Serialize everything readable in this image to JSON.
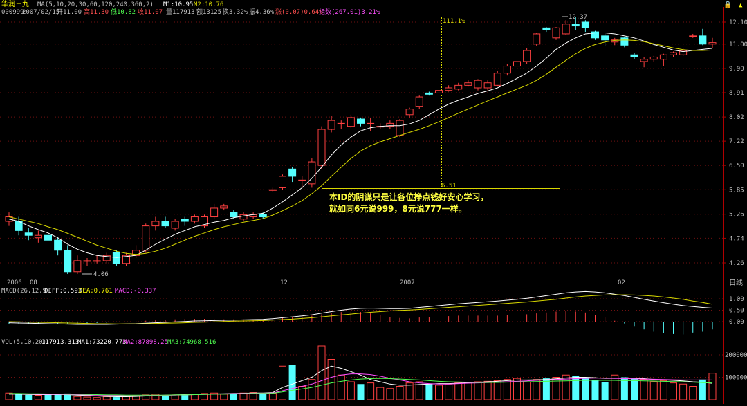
{
  "header": {
    "stock_name": "华润三九",
    "ma_params": "MA(5,10,20,30,60,120,240,360,2)",
    "m1": "M1:10.95",
    "m2": "M2:10.76",
    "code": "000999",
    "date": "2007/02/15",
    "open": "开11.00",
    "high": "高11.30",
    "low": "低10.82",
    "close": "收11.07",
    "volume": "量117913",
    "amount": "额13125",
    "turnover": "换3.32%",
    "amplitude": "振4.36%",
    "change": "涨(0.07)0.64%",
    "index": "指数(267.01)3.21%",
    "colors": {
      "name": "#ffff00",
      "label": "#c0c0c0",
      "up": "#ff5050",
      "down": "#50ff50",
      "index": "#ff50ff"
    }
  },
  "annotation": {
    "line1": "本ID的阴谋只是让各位挣点钱好安心学习，",
    "line2": "就如同6元说999，8元说777一样。",
    "pct_label": "111.1%",
    "low_mark": "6.51",
    "peak_mark": "12.37",
    "min_mark": "4.06"
  },
  "time_axis": {
    "labels": [
      "2006",
      "08",
      "12",
      "2007",
      "02"
    ],
    "period": "日线"
  },
  "macd_header": {
    "name": "MACD(26,12,9)",
    "diff": "DIFF:0.593",
    "dea": "DEA:0.761",
    "macd": "MACD:-0.337"
  },
  "vol_header": {
    "name": "VOL(5,10,20)",
    "value": "117913.313",
    "ma1": "MA1:73220.773",
    "ma2": "MA2:87898.25",
    "ma3": "MA3:74968.516"
  },
  "chart_data": [
    {
      "type": "candlestick",
      "title": "",
      "ylim": [
        4.0,
        12.4
      ],
      "ytick_labels": [
        "12.10",
        "11.00",
        "9.90",
        "8.91",
        "8.02",
        "7.22",
        "6.50",
        "5.85",
        "5.26",
        "4.74",
        "4.26"
      ],
      "candles": [
        [
          5.1,
          5.2,
          5.3,
          5.0
        ],
        [
          5.1,
          4.9,
          5.2,
          4.8
        ],
        [
          4.85,
          4.8,
          4.95,
          4.7
        ],
        [
          4.75,
          4.8,
          4.9,
          4.65
        ],
        [
          4.8,
          4.7,
          4.9,
          4.6
        ],
        [
          4.7,
          4.5,
          4.75,
          4.4
        ],
        [
          4.5,
          4.1,
          4.6,
          4.06
        ],
        [
          4.1,
          4.3,
          4.4,
          4.06
        ],
        [
          4.3,
          4.3,
          4.35,
          4.2
        ],
        [
          4.3,
          4.3,
          4.4,
          4.25
        ],
        [
          4.3,
          4.4,
          4.45,
          4.25
        ],
        [
          4.45,
          4.25,
          4.5,
          4.2
        ],
        [
          4.25,
          4.4,
          4.45,
          4.2
        ],
        [
          4.4,
          4.5,
          4.6,
          4.35
        ],
        [
          4.5,
          5.0,
          5.05,
          4.45
        ],
        [
          5.0,
          5.1,
          5.2,
          4.9
        ],
        [
          5.1,
          5.0,
          5.2,
          4.95
        ],
        [
          4.95,
          5.1,
          5.15,
          4.9
        ],
        [
          5.15,
          5.1,
          5.2,
          5.0
        ],
        [
          5.1,
          5.2,
          5.25,
          5.05
        ],
        [
          5.0,
          5.2,
          5.25,
          4.95
        ],
        [
          5.2,
          5.4,
          5.5,
          5.15
        ],
        [
          5.4,
          5.45,
          5.5,
          5.35
        ],
        [
          5.3,
          5.2,
          5.35,
          5.15
        ],
        [
          5.15,
          5.25,
          5.3,
          5.1
        ],
        [
          5.2,
          5.25,
          5.3,
          5.15
        ],
        [
          5.25,
          5.2,
          5.3,
          5.15
        ],
        [
          5.85,
          5.85,
          5.9,
          5.8
        ],
        [
          5.9,
          6.2,
          6.25,
          5.85
        ],
        [
          6.4,
          6.2,
          6.45,
          6.05
        ],
        [
          6.1,
          6.1,
          6.2,
          5.9
        ],
        [
          6.0,
          6.6,
          6.7,
          5.9
        ],
        [
          6.5,
          7.6,
          7.7,
          6.4
        ],
        [
          7.6,
          7.9,
          8.05,
          7.5
        ],
        [
          7.8,
          7.8,
          7.9,
          7.6
        ],
        [
          7.7,
          8.0,
          8.1,
          7.65
        ],
        [
          7.95,
          7.8,
          8.0,
          7.7
        ],
        [
          7.8,
          7.8,
          8.0,
          7.55
        ],
        [
          7.7,
          7.7,
          7.8,
          7.6
        ],
        [
          7.7,
          7.8,
          7.9,
          7.6
        ],
        [
          7.4,
          7.9,
          7.95,
          7.35
        ],
        [
          8.1,
          8.3,
          8.35,
          8.0
        ],
        [
          8.4,
          8.75,
          8.8,
          8.3
        ],
        [
          8.9,
          8.85,
          8.95,
          8.8
        ],
        [
          8.9,
          9.0,
          9.05,
          8.8
        ],
        [
          9.0,
          9.1,
          9.2,
          8.95
        ],
        [
          9.05,
          9.2,
          9.3,
          9.0
        ],
        [
          9.2,
          9.3,
          9.4,
          9.15
        ],
        [
          9.1,
          9.4,
          9.45,
          9.0
        ],
        [
          9.1,
          9.3,
          9.4,
          9.0
        ],
        [
          9.2,
          9.7,
          9.8,
          9.15
        ],
        [
          9.7,
          10.0,
          10.1,
          9.6
        ],
        [
          10.0,
          10.2,
          10.25,
          9.9
        ],
        [
          10.2,
          10.7,
          10.8,
          10.1
        ],
        [
          11.0,
          11.5,
          11.55,
          10.9
        ],
        [
          11.8,
          11.7,
          11.85,
          11.6
        ],
        [
          11.3,
          11.8,
          11.85,
          11.2
        ],
        [
          11.5,
          12.0,
          12.2,
          11.45
        ],
        [
          12.0,
          11.9,
          12.37,
          11.7
        ],
        [
          12.1,
          11.8,
          12.2,
          11.6
        ],
        [
          11.6,
          11.3,
          11.65,
          11.2
        ],
        [
          11.4,
          11.2,
          11.5,
          10.9
        ],
        [
          11.1,
          11.2,
          11.3,
          10.95
        ],
        [
          11.3,
          10.95,
          11.35,
          10.85
        ],
        [
          10.5,
          10.4,
          10.6,
          10.3
        ],
        [
          10.2,
          10.3,
          10.4,
          9.95
        ],
        [
          10.3,
          10.4,
          10.45,
          10.2
        ],
        [
          10.3,
          10.5,
          10.55,
          10.0
        ],
        [
          10.5,
          10.6,
          10.65,
          10.4
        ],
        [
          10.5,
          10.7,
          10.8,
          10.45
        ],
        [
          11.4,
          11.4,
          11.5,
          11.3
        ],
        [
          11.4,
          11.0,
          11.75,
          10.95
        ],
        [
          11.0,
          11.07,
          11.3,
          10.82
        ]
      ],
      "ma_short": [
        5.15,
        5.1,
        5.0,
        4.92,
        4.85,
        4.75,
        4.62,
        4.52,
        4.45,
        4.4,
        4.38,
        4.36,
        4.38,
        4.4,
        4.5,
        4.62,
        4.72,
        4.82,
        4.9,
        4.98,
        5.03,
        5.08,
        5.12,
        5.18,
        5.22,
        5.25,
        5.28,
        5.4,
        5.55,
        5.72,
        5.9,
        6.15,
        6.45,
        6.8,
        7.1,
        7.35,
        7.55,
        7.65,
        7.7,
        7.72,
        7.72,
        7.78,
        7.9,
        8.1,
        8.3,
        8.48,
        8.62,
        8.75,
        8.88,
        8.98,
        9.1,
        9.28,
        9.48,
        9.7,
        10.0,
        10.35,
        10.75,
        11.05,
        11.3,
        11.5,
        11.55,
        11.55,
        11.5,
        11.4,
        11.3,
        11.15,
        10.98,
        10.85,
        10.72,
        10.65,
        10.7,
        10.75,
        10.8
      ],
      "ma_long": [
        5.2,
        5.15,
        5.1,
        5.05,
        4.98,
        4.92,
        4.84,
        4.76,
        4.68,
        4.6,
        4.54,
        4.48,
        4.44,
        4.42,
        4.44,
        4.48,
        4.54,
        4.62,
        4.7,
        4.78,
        4.85,
        4.92,
        4.98,
        5.03,
        5.08,
        5.12,
        5.16,
        5.24,
        5.34,
        5.45,
        5.58,
        5.75,
        5.95,
        6.2,
        6.45,
        6.7,
        6.92,
        7.08,
        7.2,
        7.3,
        7.4,
        7.5,
        7.6,
        7.72,
        7.85,
        8.0,
        8.15,
        8.3,
        8.45,
        8.6,
        8.75,
        8.9,
        9.05,
        9.2,
        9.4,
        9.65,
        9.95,
        10.25,
        10.55,
        10.8,
        10.98,
        11.1,
        11.18,
        11.2,
        11.18,
        11.12,
        11.02,
        10.92,
        10.82,
        10.74,
        10.7,
        10.7,
        10.72
      ]
    },
    {
      "type": "macd",
      "ylim": [
        0,
        1.5
      ],
      "ytick_labels": [
        "1.00",
        "0.50",
        "0.00"
      ],
      "diff": [
        -0.05,
        -0.06,
        -0.07,
        -0.08,
        -0.09,
        -0.1,
        -0.11,
        -0.12,
        -0.12,
        -0.12,
        -0.12,
        -0.11,
        -0.1,
        -0.09,
        -0.07,
        -0.05,
        -0.03,
        -0.01,
        0.01,
        0.03,
        0.04,
        0.05,
        0.06,
        0.07,
        0.08,
        0.09,
        0.1,
        0.13,
        0.17,
        0.21,
        0.25,
        0.3,
        0.37,
        0.44,
        0.5,
        0.55,
        0.58,
        0.59,
        0.58,
        0.57,
        0.57,
        0.58,
        0.62,
        0.66,
        0.7,
        0.74,
        0.78,
        0.81,
        0.84,
        0.87,
        0.9,
        0.94,
        0.98,
        1.02,
        1.08,
        1.14,
        1.2,
        1.26,
        1.3,
        1.32,
        1.3,
        1.26,
        1.2,
        1.14,
        1.06,
        0.98,
        0.9,
        0.83,
        0.76,
        0.7,
        0.66,
        0.62,
        0.59
      ],
      "dea": [
        0,
        -0.01,
        -0.02,
        -0.03,
        -0.04,
        -0.05,
        -0.06,
        -0.07,
        -0.08,
        -0.09,
        -0.09,
        -0.1,
        -0.1,
        -0.1,
        -0.09,
        -0.08,
        -0.07,
        -0.06,
        -0.05,
        -0.03,
        -0.02,
        -0.01,
        0.01,
        0.02,
        0.03,
        0.04,
        0.05,
        0.07,
        0.09,
        0.11,
        0.14,
        0.17,
        0.21,
        0.25,
        0.29,
        0.33,
        0.37,
        0.41,
        0.44,
        0.47,
        0.49,
        0.51,
        0.53,
        0.56,
        0.59,
        0.62,
        0.65,
        0.68,
        0.71,
        0.74,
        0.77,
        0.8,
        0.83,
        0.86,
        0.9,
        0.94,
        0.98,
        1.03,
        1.08,
        1.12,
        1.15,
        1.17,
        1.18,
        1.18,
        1.17,
        1.15,
        1.12,
        1.08,
        1.03,
        0.98,
        0.9,
        0.84,
        0.76
      ]
    },
    {
      "type": "bar",
      "ylim": [
        0,
        240000
      ],
      "ytick_labels": [
        "200000",
        "100000"
      ],
      "volume": [
        30000,
        28000,
        22000,
        20000,
        25000,
        24000,
        28000,
        15000,
        12000,
        10000,
        14000,
        12000,
        15000,
        18000,
        22000,
        25000,
        20000,
        22000,
        24000,
        25000,
        28000,
        30000,
        25000,
        28000,
        30000,
        32000,
        25000,
        28000,
        150000,
        155000,
        60000,
        90000,
        240000,
        180000,
        110000,
        80000,
        70000,
        75000,
        55000,
        50000,
        60000,
        75000,
        80000,
        70000,
        65000,
        70000,
        75000,
        78000,
        80000,
        82000,
        85000,
        90000,
        95000,
        80000,
        90000,
        95000,
        100000,
        110000,
        105000,
        95000,
        85000,
        80000,
        110000,
        100000,
        95000,
        90000,
        80000,
        85000,
        75000,
        70000,
        60000,
        90000,
        117913
      ],
      "ma_a": [
        25000,
        25000,
        24000,
        23000,
        23000,
        24000,
        23000,
        21000,
        19000,
        17000,
        15000,
        14000,
        14000,
        15000,
        17000,
        19000,
        21000,
        22000,
        23000,
        24000,
        25000,
        26000,
        27000,
        28000,
        29000,
        30000,
        30000,
        32000,
        55000,
        70000,
        85000,
        100000,
        130000,
        150000,
        140000,
        125000,
        110000,
        90000,
        80000,
        70000,
        65000,
        65000,
        68000,
        70000,
        72000,
        72000,
        74000,
        76000,
        78000,
        80000,
        82000,
        85000,
        88000,
        88000,
        89000,
        90000,
        93000,
        97000,
        100000,
        100000,
        98000,
        95000,
        95000,
        96000,
        96000,
        94000,
        90000,
        88000,
        86000,
        84000,
        80000,
        78000,
        73000
      ],
      "ma_b": [
        27000,
        27000,
        26000,
        25000,
        25000,
        25000,
        24000,
        23000,
        22000,
        21000,
        20000,
        19000,
        18000,
        18000,
        18000,
        19000,
        20000,
        21000,
        22000,
        23000,
        24000,
        25000,
        26000,
        27000,
        28000,
        29000,
        29000,
        30000,
        40000,
        50000,
        60000,
        70000,
        85000,
        100000,
        110000,
        115000,
        115000,
        112000,
        105000,
        95000,
        88000,
        80000,
        75000,
        72000,
        70000,
        70000,
        72000,
        74000,
        75000,
        76000,
        78000,
        80000,
        82000,
        84000,
        86000,
        88000,
        90000,
        92000,
        94000,
        95000,
        96000,
        96000,
        95000,
        94000,
        93000,
        92000,
        91000,
        90000,
        89000,
        88000,
        88000,
        88000,
        88000
      ],
      "ma_c": [
        28000,
        28000,
        27000,
        27000,
        26000,
        26000,
        25000,
        25000,
        24000,
        23000,
        22000,
        22000,
        21000,
        21000,
        21000,
        21000,
        21000,
        22000,
        22000,
        23000,
        24000,
        25000,
        25000,
        26000,
        27000,
        28000,
        28000,
        29000,
        35000,
        42000,
        48000,
        55000,
        65000,
        75000,
        82000,
        88000,
        92000,
        94000,
        95000,
        94000,
        92000,
        90000,
        88000,
        85000,
        82000,
        80000,
        79000,
        78000,
        77000,
        77000,
        77000,
        78000,
        79000,
        80000,
        81000,
        82000,
        83000,
        84000,
        85000,
        86000,
        86000,
        86000,
        86000,
        85000,
        85000,
        84000,
        83000,
        82000,
        81000,
        80000,
        78000,
        76000,
        75000
      ]
    }
  ]
}
